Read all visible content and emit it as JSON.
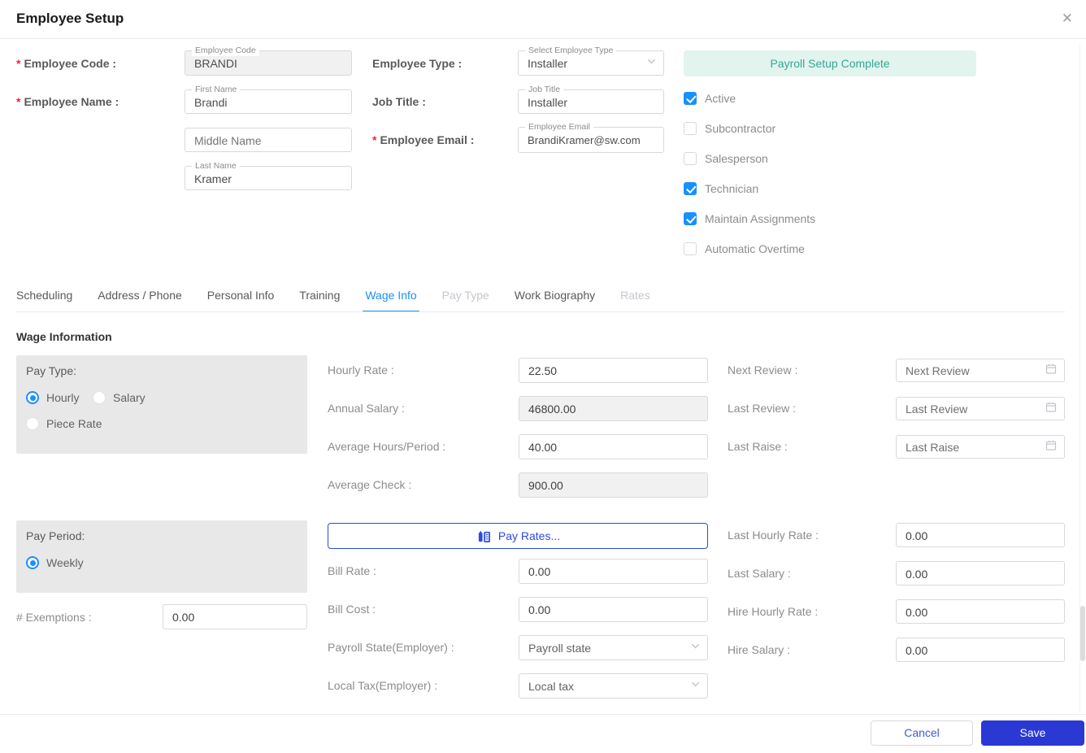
{
  "ui": {
    "required_mark": "*"
  },
  "header": {
    "title": "Employee Setup",
    "close_icon": "✕"
  },
  "top_form": {
    "employee_code": {
      "label": "Employee Code :",
      "float_label": "Employee Code",
      "value": "BRANDI",
      "disabled": true
    },
    "employee_type": {
      "label": "Employee Type :",
      "float_label": "Select Employee Type",
      "value": "Installer"
    },
    "payroll_setup_button": "Payroll Setup Complete",
    "employee_name": {
      "label": "Employee Name :",
      "float_label": "First Name",
      "value": "Brandi"
    },
    "job_title": {
      "label": "Job Title :",
      "float_label": "Job Title",
      "value": "Installer"
    },
    "middle_name": {
      "placeholder": "Middle Name"
    },
    "employee_email": {
      "label": "Employee Email :",
      "float_label": "Employee Email",
      "value": "BrandiKramer@sw.com"
    },
    "last_name": {
      "float_label": "Last Name",
      "value": "Kramer"
    },
    "checkboxes": [
      {
        "label": "Active",
        "checked": true
      },
      {
        "label": "Subcontractor",
        "checked": false
      },
      {
        "label": "Salesperson",
        "checked": false
      },
      {
        "label": "Technician",
        "checked": true
      },
      {
        "label": "Maintain Assignments",
        "checked": true
      },
      {
        "label": "Automatic Overtime",
        "checked": false
      }
    ]
  },
  "tabs": [
    {
      "label": "Scheduling"
    },
    {
      "label": "Address / Phone"
    },
    {
      "label": "Personal Info"
    },
    {
      "label": "Training"
    },
    {
      "label": "Wage Info",
      "active": true
    },
    {
      "label": "Pay Type",
      "disabled": true
    },
    {
      "label": "Work Biography"
    },
    {
      "label": "Rates",
      "disabled": true
    }
  ],
  "wage_info": {
    "section_title": "Wage Information",
    "pay_type_panel": {
      "label": "Pay Type:",
      "options": [
        {
          "label": "Hourly",
          "selected": true
        },
        {
          "label": "Salary",
          "selected": false
        },
        {
          "label": "Piece Rate",
          "selected": false
        }
      ]
    },
    "hourly_rate": {
      "label": "Hourly Rate :",
      "value": "22.50"
    },
    "annual_salary": {
      "label": "Annual Salary :",
      "value": "46800.00",
      "disabled": true
    },
    "average_hours": {
      "label": "Average Hours/Period :",
      "value": "40.00"
    },
    "average_check": {
      "label": "Average Check :",
      "value": "900.00",
      "disabled": true
    },
    "next_review": {
      "label": "Next Review :",
      "placeholder": "Next Review"
    },
    "last_review": {
      "label": "Last Review :",
      "placeholder": "Last Review"
    },
    "last_raise": {
      "label": "Last Raise :",
      "placeholder": "Last Raise"
    },
    "pay_period_panel": {
      "label": "Pay Period:",
      "options": [
        {
          "label": "Weekly",
          "selected": true
        }
      ]
    },
    "exemptions": {
      "label": "# Exemptions :",
      "value": "0.00"
    },
    "pay_rates_button": "Pay Rates...",
    "bill_rate": {
      "label": "Bill Rate :",
      "value": "0.00"
    },
    "bill_cost": {
      "label": "Bill Cost :",
      "value": "0.00"
    },
    "payroll_state": {
      "label": "Payroll State(Employer) :",
      "placeholder": "Payroll state"
    },
    "local_tax": {
      "label": "Local Tax(Employer) :",
      "placeholder": "Local tax"
    },
    "last_hourly_rate": {
      "label": "Last Hourly Rate :",
      "value": "0.00"
    },
    "last_salary": {
      "label": "Last Salary :",
      "value": "0.00"
    },
    "hire_hourly_rate": {
      "label": "Hire Hourly Rate :",
      "value": "0.00"
    },
    "hire_salary": {
      "label": "Hire Salary :",
      "value": "0.00"
    }
  },
  "footer": {
    "cancel_label": "Cancel",
    "save_label": "Save"
  },
  "colors": {
    "accent_blue": "#1890ff",
    "primary_blue": "#2a38d4",
    "pay_rates_blue": "#2b4bdf",
    "teal_text": "#36a794",
    "teal_bg": "#e2f4ee",
    "required_red": "#f5222d",
    "panel_gray": "#e8e8e8"
  }
}
